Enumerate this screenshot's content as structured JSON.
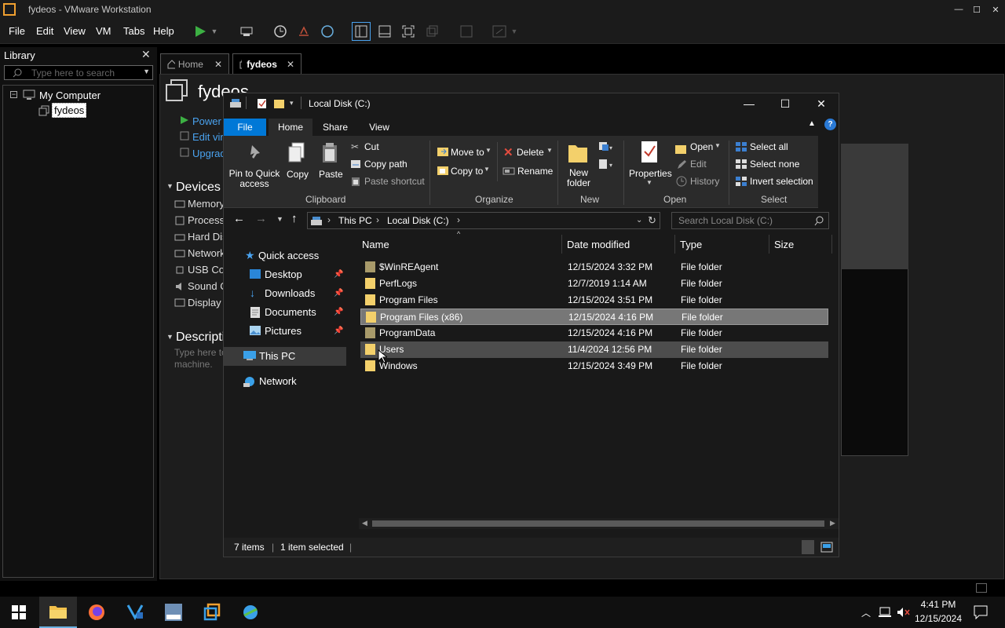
{
  "vm_window": {
    "title": "fydeos - VMware Workstation"
  },
  "menu": {
    "file": "File",
    "edit": "Edit",
    "view": "View",
    "vm": "VM",
    "tabs": "Tabs",
    "help": "Help"
  },
  "library": {
    "header": "Library",
    "search_placeholder": "Type here to search",
    "tree": {
      "root": "My Computer",
      "child": "fydeos"
    }
  },
  "tabs": [
    {
      "label": "Home"
    },
    {
      "label": "fydeos"
    }
  ],
  "vm_page": {
    "title": "fydeos",
    "actions": [
      "Power",
      "Edit virt",
      "Upgrad"
    ],
    "devices_header": "Devices",
    "devices": [
      "Memory",
      "Processo",
      "Hard Dis",
      "Network",
      "USB Con",
      "Sound C",
      "Display"
    ],
    "description_header": "Descriptio",
    "description_text": "Type here to",
    "description_text2": "machine."
  },
  "explorer": {
    "title": "Local Disk (C:)",
    "ribbon_tabs": [
      "File",
      "Home",
      "Share",
      "View"
    ],
    "clipboard": {
      "pin": "Pin to Quick access",
      "copy": "Copy",
      "paste": "Paste",
      "cut": "Cut",
      "copy_path": "Copy path",
      "paste_shortcut": "Paste shortcut",
      "group": "Clipboard"
    },
    "organize": {
      "move_to": "Move to",
      "copy_to": "Copy to",
      "delete": "Delete",
      "rename": "Rename",
      "group": "Organize"
    },
    "new": {
      "new_folder": "New folder",
      "group": "New"
    },
    "open": {
      "properties": "Properties",
      "open": "Open",
      "edit": "Edit",
      "history": "History",
      "group": "Open"
    },
    "select": {
      "select_all": "Select all",
      "select_none": "Select none",
      "invert": "Invert selection",
      "group": "Select"
    },
    "breadcrumb": [
      "This PC",
      "Local Disk (C:)"
    ],
    "search_placeholder": "Search Local Disk (C:)",
    "nav": {
      "quick_access": "Quick access",
      "items": [
        "Desktop",
        "Downloads",
        "Documents",
        "Pictures"
      ],
      "this_pc": "This PC",
      "network": "Network"
    },
    "columns": [
      "Name",
      "Date modified",
      "Type",
      "Size"
    ],
    "files": [
      {
        "name": "$WinREAgent",
        "date": "12/15/2024 3:32 PM",
        "type": "File folder"
      },
      {
        "name": "PerfLogs",
        "date": "12/7/2019 1:14 AM",
        "type": "File folder"
      },
      {
        "name": "Program Files",
        "date": "12/15/2024 3:51 PM",
        "type": "File folder"
      },
      {
        "name": "Program Files (x86)",
        "date": "12/15/2024 4:16 PM",
        "type": "File folder"
      },
      {
        "name": "ProgramData",
        "date": "12/15/2024 4:16 PM",
        "type": "File folder"
      },
      {
        "name": "Users",
        "date": "11/4/2024 12:56 PM",
        "type": "File folder"
      },
      {
        "name": "Windows",
        "date": "12/15/2024 3:49 PM",
        "type": "File folder"
      }
    ],
    "status": {
      "items": "7 items",
      "selected": "1 item selected"
    }
  },
  "taskbar": {
    "time": "4:41 PM",
    "date": "12/15/2024"
  },
  "colors": {
    "accent": "#0078d7",
    "folder": "#f3d06b",
    "bg": "#191919"
  }
}
